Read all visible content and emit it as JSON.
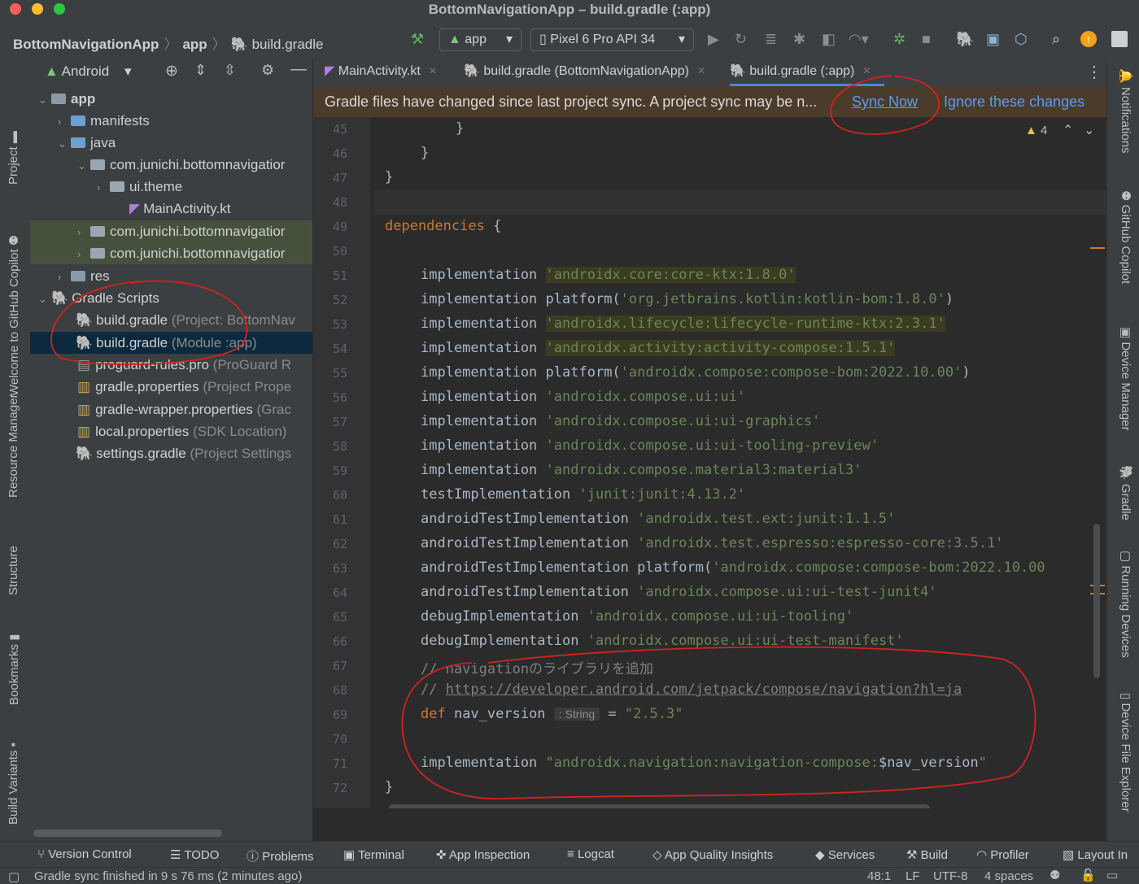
{
  "window": {
    "title": "BottomNavigationApp – build.gradle (:app)"
  },
  "breadcrumb": {
    "project": "BottomNavigationApp",
    "module": "app",
    "file": "build.gradle"
  },
  "toolbar": {
    "run_config": "app",
    "device": "Pixel 6 Pro API 34"
  },
  "project_panel": {
    "view_mode": "Android",
    "tree": {
      "app": "app",
      "manifests": "manifests",
      "java": "java",
      "pkg_main": "com.junichi.bottomnavigatior",
      "ui_theme": "ui.theme",
      "main_activity": "MainActivity.kt",
      "pkg_test1": "com.junichi.bottomnavigatior",
      "pkg_test2": "com.junichi.bottomnavigatior",
      "res": "res",
      "gradle_scripts": "Gradle Scripts",
      "bg_project": "build.gradle",
      "bg_project_hint": "(Project: BottomNav",
      "bg_module": "build.gradle",
      "bg_module_hint": "(Module :app)",
      "proguard": "proguard-rules.pro",
      "proguard_hint": "(ProGuard R",
      "gradle_props": "gradle.properties",
      "gradle_props_hint": "(Project Prope",
      "wrapper_props": "gradle-wrapper.properties",
      "wrapper_props_hint": "(Grac",
      "local_props": "local.properties",
      "local_props_hint": "(SDK Location)",
      "settings": "settings.gradle",
      "settings_hint": "(Project Settings"
    }
  },
  "left_tool_tabs": [
    "Project",
    "Welcome to GitHub Copilot",
    "Resource Manager",
    "Structure",
    "Bookmarks",
    "Build Variants"
  ],
  "right_tool_tabs": [
    "Notifications",
    "GitHub Copilot",
    "Device Manager",
    "Gradle",
    "Running Devices",
    "Device File Explorer"
  ],
  "editor_tabs": [
    "MainActivity.kt",
    "build.gradle (BottomNavigationApp)",
    "build.gradle (:app)"
  ],
  "banner": {
    "message": "Gradle files have changed since last project sync. A project sync may be n...",
    "sync_now": "Sync Now",
    "ignore": "Ignore these changes"
  },
  "inspection": {
    "warnings": "4"
  },
  "code": {
    "line_numbers": [
      "45",
      "46",
      "47",
      "48",
      "49",
      "50",
      "51",
      "52",
      "53",
      "54",
      "55",
      "56",
      "57",
      "58",
      "59",
      "60",
      "61",
      "62",
      "63",
      "64",
      "65",
      "66",
      "67",
      "68",
      "69",
      "70",
      "71",
      "72"
    ],
    "l45": "}",
    "l46": "}",
    "l47": "}",
    "l49_kw": "dependencies",
    "l49_rest": " {",
    "impl": "implementation",
    "l51_str": "'androidx.core:core-ktx:1.8.0'",
    "platform": "platform(",
    "l52_str": "'org.jetbrains.kotlin:kotlin-bom:1.8.0'",
    "close_paren": ")",
    "l53_str": "'androidx.lifecycle:lifecycle-runtime-ktx:2.3.1'",
    "l54_str": "'androidx.activity:activity-compose:1.5.1'",
    "l55_str": "'androidx.compose:compose-bom:2022.10.00'",
    "l56_str": "'androidx.compose.ui:ui'",
    "l57_str": "'androidx.compose.ui:ui-graphics'",
    "l58_str": "'androidx.compose.ui:ui-tooling-preview'",
    "l59_str": "'androidx.compose.material3:material3'",
    "test_impl": "testImplementation",
    "l60_str": "'junit:junit:4.13.2'",
    "android_test_impl": "androidTestImplementation",
    "l61_str": "'androidx.test.ext:junit:1.1.5'",
    "l62_str": "'androidx.test.espresso:espresso-core:3.5.1'",
    "l63_str": "'androidx.compose:compose-bom:2022.10.00",
    "l64_str": "'androidx.compose.ui:ui-test-junit4'",
    "debug_impl": "debugImplementation",
    "l65_str": "'androidx.compose.ui:ui-tooling'",
    "l66_str": "'androidx.compose.ui:ui-test-manifest'",
    "l67": "// navigationのライブラリを追加",
    "l68_prefix": "// ",
    "l68_url": "https://developer.android.com/jetpack/compose/navigation?hl=ja",
    "l69_kw": "def",
    "l69_name": " nav_version",
    "l69_hint": ": String",
    "l69_eq": " = ",
    "l69_str": "\"2.5.3\"",
    "l71_str_a": "\"androidx.navigation:navigation-compose:",
    "l71_var": "$nav_version",
    "l71_str_b": "\"",
    "l72": "}"
  },
  "bottom_tools": [
    "Version Control",
    "TODO",
    "Problems",
    "Terminal",
    "App Inspection",
    "Logcat",
    "App Quality Insights",
    "Services",
    "Build",
    "Profiler",
    "Layout In"
  ],
  "status": {
    "message": "Gradle sync finished in 9 s 76 ms (2 minutes ago)",
    "position": "48:1",
    "line_sep": "LF",
    "encoding": "UTF-8",
    "indent": "4 spaces"
  },
  "colors": {
    "accent": "#4a88c7",
    "annotation": "#d2231e",
    "banner_bg": "#4b3b2a"
  }
}
